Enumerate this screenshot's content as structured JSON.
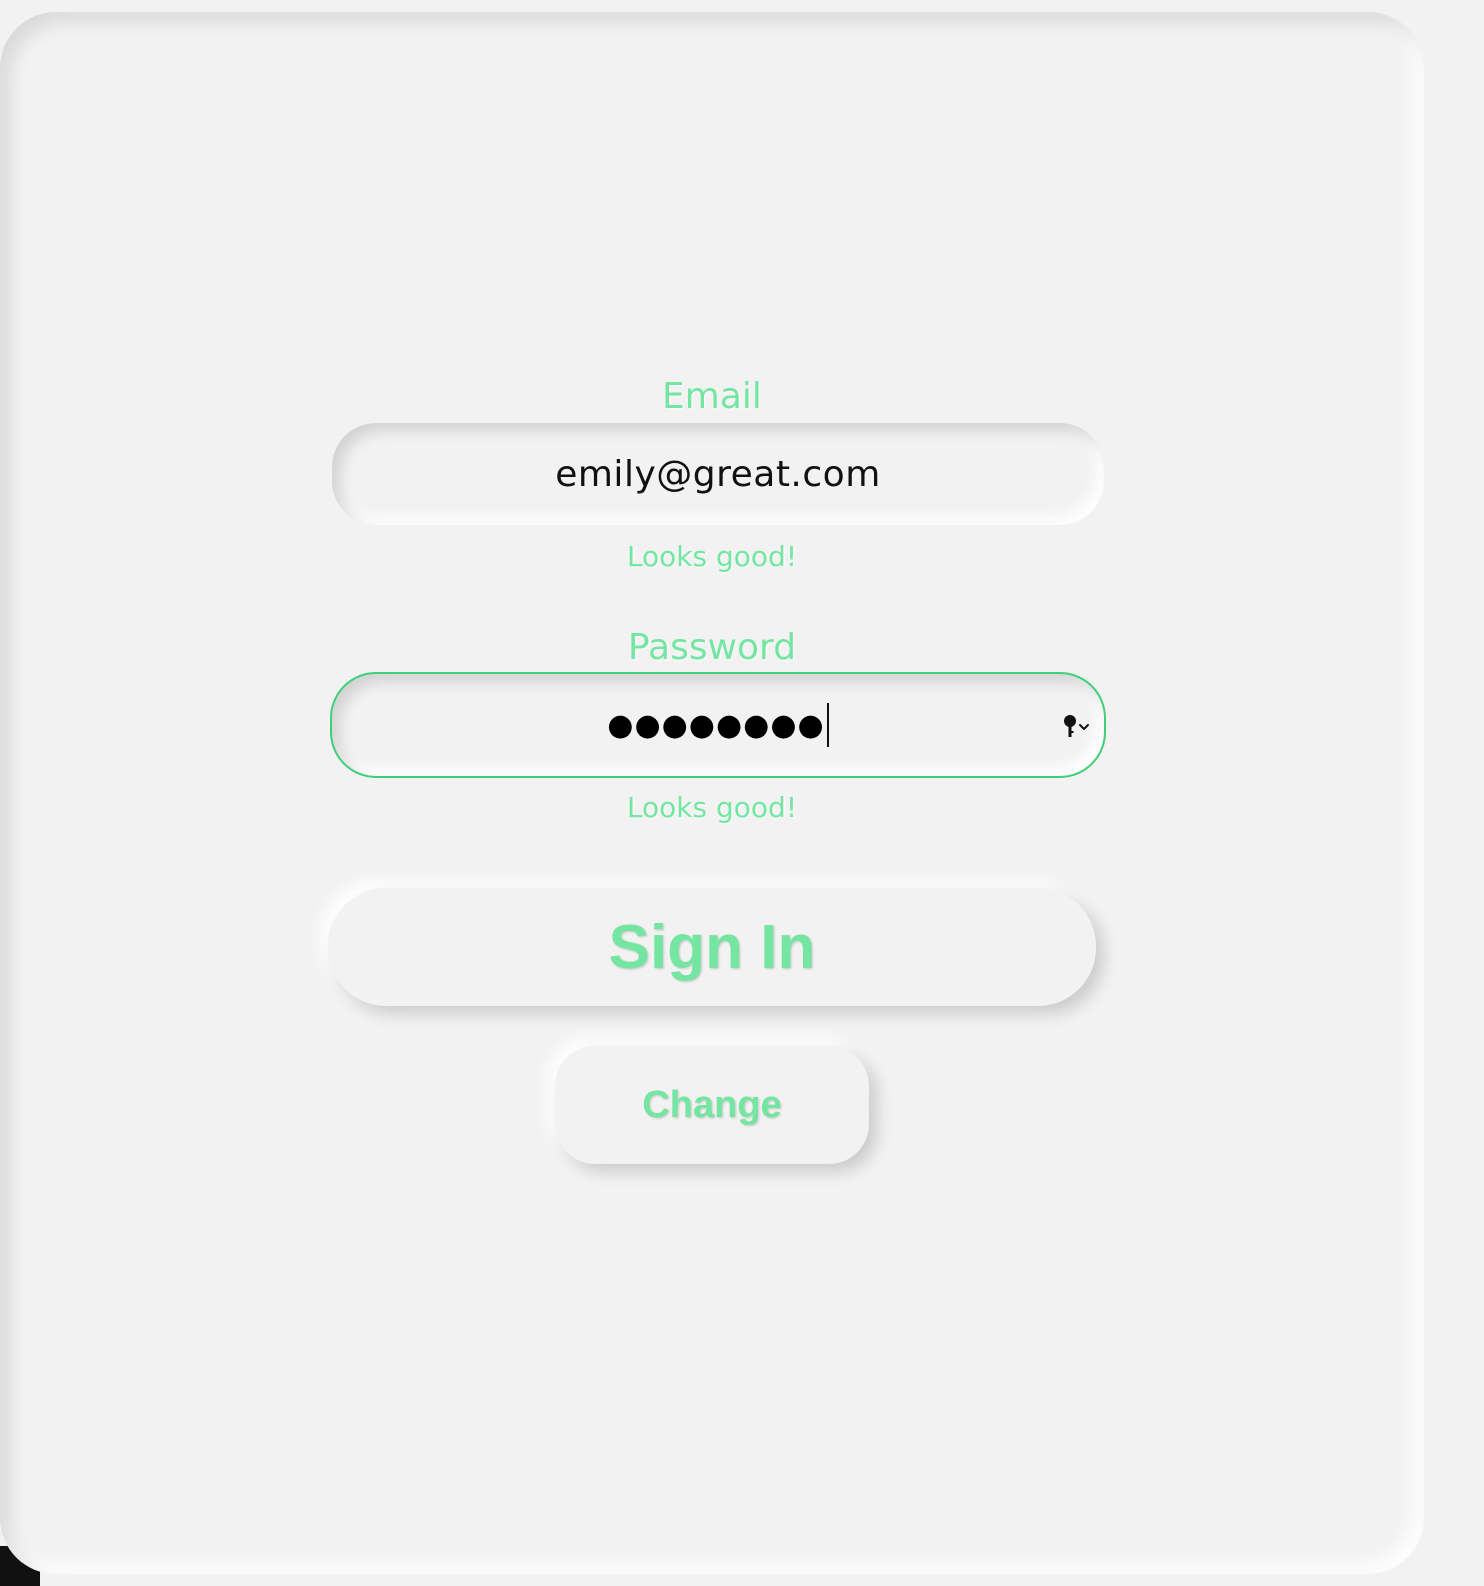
{
  "form": {
    "email": {
      "label": "Email",
      "value": "emily@great.com",
      "hint": "Looks good!"
    },
    "password": {
      "label": "Password",
      "value_masked": "●●●●●●●●",
      "hint": "Looks good!",
      "icon": "key-autofill-icon"
    }
  },
  "buttons": {
    "signin_label": "Sign In",
    "change_label": "Change"
  },
  "colors": {
    "accent": "#74e6a2",
    "valid_border": "#3fcf78",
    "background": "#f2f2f2"
  }
}
